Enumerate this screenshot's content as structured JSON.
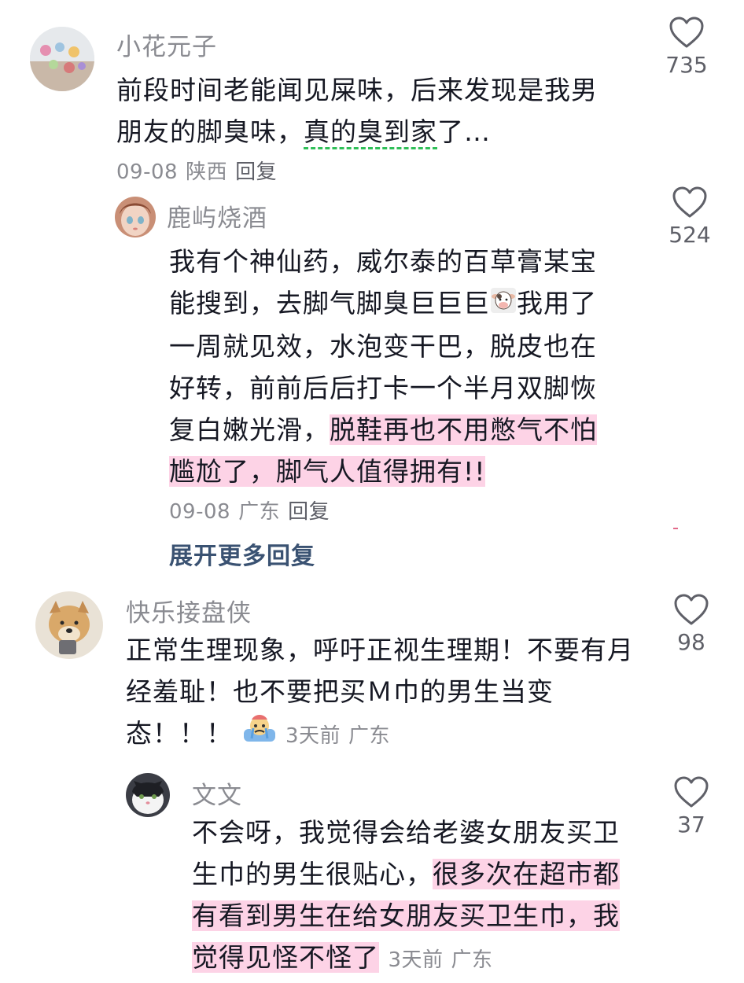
{
  "comments": [
    {
      "username": "小花元子",
      "text_plain": "前段时间老能闻见屎味，后来发现是我男朋友的脚臭味，",
      "text_underlined": "真的臭到家",
      "text_tail": "了…",
      "date": "09-08",
      "location": "陕西",
      "reply_label": "回复",
      "likes": "735",
      "replies": [
        {
          "username": "鹿屿烧酒",
          "text_a": "我有个神仙药，威尔泰的百草膏某宝能搜到，去脚气脚臭巨巨巨",
          "text_b": "我用了一周就见效，水泡变干巴，脱皮也在好转，前前后后打卡一个半月双脚恢复白嫩光滑，",
          "text_highlight": "脱鞋再也不用憋气不怕尴尬了，脚气人值得拥有!!",
          "date": "09-08",
          "location": "广东",
          "reply_label": "回复",
          "likes": "524",
          "emoji_icon": "cow-face-icon"
        }
      ],
      "expand_label": "展开更多回复"
    },
    {
      "username": "快乐接盘侠",
      "text": "正常生理现象，呼吁正视生理期！不要有月经羞耻！也不要把买Ｍ巾的男生当变态！！！",
      "emoji_icon": "crying-face-icon",
      "time": "3天前",
      "location": "广东",
      "likes": "98",
      "replies": [
        {
          "username": "文文",
          "text_plain": "不会呀，我觉得会给老婆女朋友买卫生巾的男生很贴心，",
          "text_highlight": "很多次在超市都有看到男生在给女朋友买卫生巾，我觉得见怪不怪了",
          "time": "3天前",
          "location": "广东",
          "likes": "37"
        }
      ]
    }
  ]
}
